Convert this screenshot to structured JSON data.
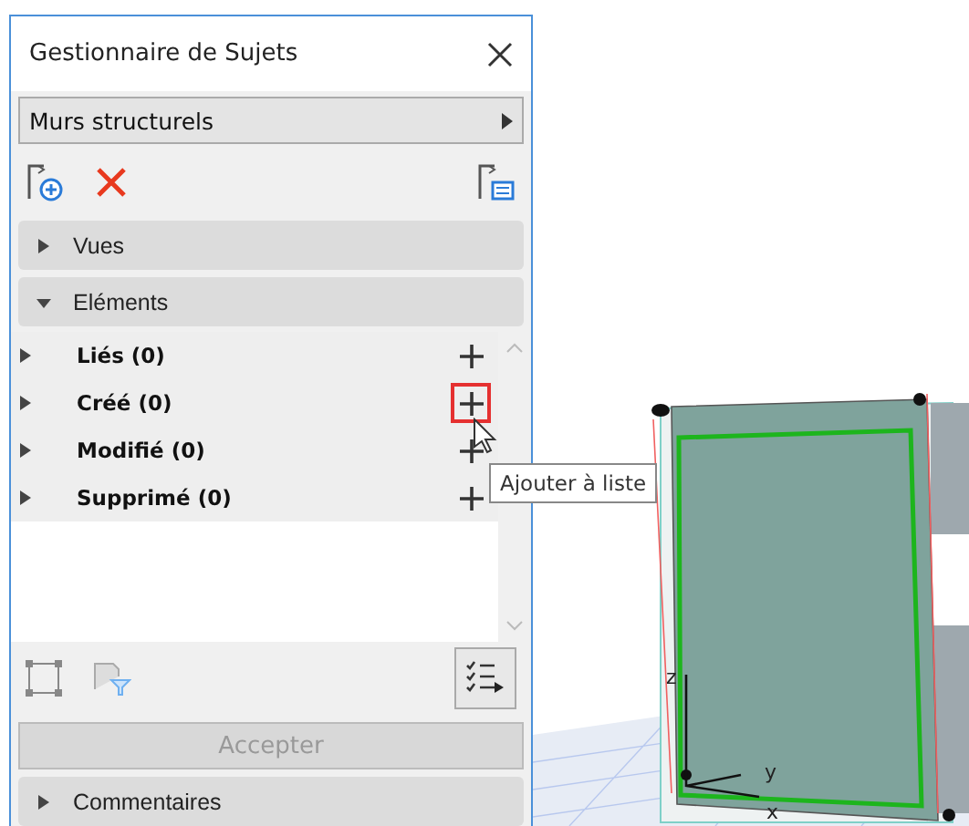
{
  "window": {
    "title": "Gestionnaire de Sujets"
  },
  "topic_selector": {
    "value": "Murs structurels"
  },
  "sections_top": [
    {
      "label": "Vues",
      "expanded": false
    },
    {
      "label": "Eléments",
      "expanded": true
    }
  ],
  "element_groups": [
    {
      "label": "Liés (0)",
      "expanded": false,
      "add_highlighted": false
    },
    {
      "label": "Créé (0)",
      "expanded": false,
      "add_highlighted": true
    },
    {
      "label": "Modifié (0)",
      "expanded": false,
      "add_highlighted": false
    },
    {
      "label": "Supprimé (0)",
      "expanded": false,
      "add_highlighted": false
    }
  ],
  "tooltip": "Ajouter à liste",
  "accept_button": {
    "label": "Accepter",
    "disabled": true
  },
  "sections_bottom": [
    {
      "label": "Commentaires",
      "expanded": false
    }
  ],
  "viewport": {
    "axes": [
      "z",
      "y",
      "x"
    ]
  }
}
